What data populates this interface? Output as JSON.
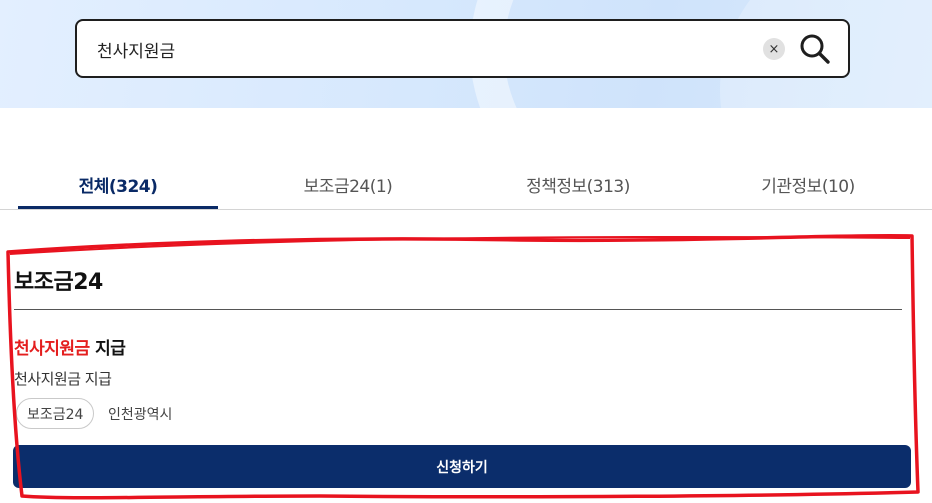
{
  "search": {
    "value": "천사지원금",
    "clear_icon": "×"
  },
  "tabs": [
    {
      "label": "전체(324)",
      "active": true
    },
    {
      "label": "보조금24(1)",
      "active": false
    },
    {
      "label": "정책정보(313)",
      "active": false
    },
    {
      "label": "기관정보(10)",
      "active": false
    }
  ],
  "section": {
    "title": "보조금24"
  },
  "result": {
    "title_highlight": "천사지원금",
    "title_rest": " 지급",
    "description": "천사지원금 지급",
    "tag": "보조금24",
    "region": "인천광역시",
    "apply_label": "신청하기"
  },
  "colors": {
    "accent": "#0b2d6b",
    "highlight": "#e41e1e",
    "annotation": "#e8131f"
  }
}
